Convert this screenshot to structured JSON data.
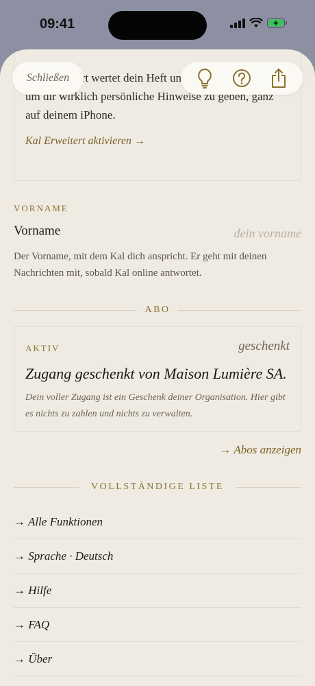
{
  "status_bar": {
    "time": "09:41"
  },
  "header": {
    "close_label": "Schließen",
    "actions": [
      "lightbulb-icon",
      "help-icon",
      "share-icon"
    ]
  },
  "intro": {
    "text": "Kal Erweitert wertet dein Heft und deine Gespräche aus, um dir wirklich persönliche Hinweise zu geben, ganz auf deinem iPhone.",
    "link": "Kal Erweitert aktivieren →"
  },
  "vorname": {
    "section_label": "VORNAME",
    "field_label": "Vorname",
    "placeholder": "dein vorname",
    "help": "Der Vorname, mit dem Kal dich anspricht. Er geht mit deinen Nachrichten mit, sobald Kal online antwortet."
  },
  "abo": {
    "section_label": "ABO",
    "status": "AKTIV",
    "badge": "geschenkt",
    "title": "Zugang geschenkt von Maison Lumière SA.",
    "description": "Dein voller Zugang ist ein Geschenk deiner Organisation. Hier gibt es nichts zu zahlen und nichts zu verwalten.",
    "link": "→ Abos anzeigen"
  },
  "full_list": {
    "section_label": "VOLLSTÄNDIGE LISTE",
    "items": [
      "→ Alle Funktionen",
      "→ Sprache · Deutsch",
      "→ Hilfe",
      "→ FAQ",
      "→ Über"
    ]
  },
  "colors": {
    "accent": "#8a7331",
    "background": "#efebe3",
    "backdrop": "#8d90a3"
  }
}
